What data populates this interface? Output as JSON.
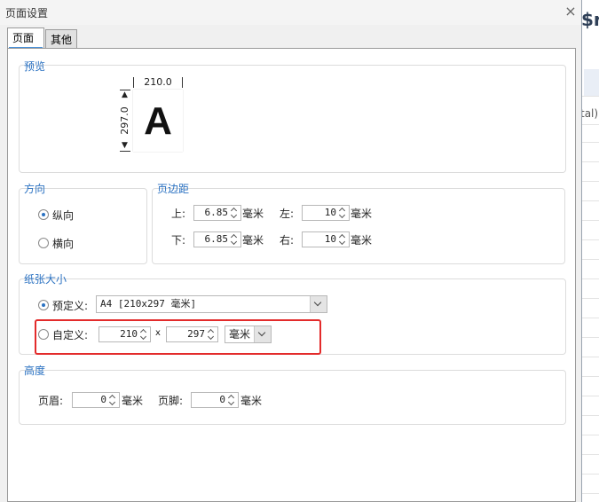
{
  "background": {
    "heading": "$r",
    "snippet": "tal)"
  },
  "dialog": {
    "title": "页面设置",
    "close_glyph": "×",
    "tabs": [
      {
        "label": "页面",
        "active": true
      },
      {
        "label": "其他",
        "active": false
      }
    ],
    "preview": {
      "label": "预览",
      "width": "210.0",
      "height": "297.0",
      "letter": "A"
    },
    "orientation": {
      "label": "方向",
      "portrait": "纵向",
      "landscape": "横向",
      "selected": "纵向"
    },
    "margins": {
      "label": "页边距",
      "top_label": "上:",
      "top": "6.85",
      "left_label": "左:",
      "left": "10",
      "bottom_label": "下:",
      "bottom": "6.85",
      "right_label": "右:",
      "right": "10",
      "unit": "毫米"
    },
    "paper": {
      "label": "纸张大小",
      "predefined_label": "预定义:",
      "predefined_value": "A4 [210x297 毫米]",
      "custom_label": "自定义:",
      "custom_width": "210",
      "times": "x",
      "custom_height": "297",
      "custom_unit": "毫米",
      "selected": "预定义"
    },
    "height_section": {
      "label": "高度",
      "header_label": "页眉:",
      "header": "0",
      "footer_label": "页脚:",
      "footer": "0",
      "unit": "毫米"
    }
  },
  "colors": {
    "accent": "#2b72c2",
    "highlight": "#e32b2b"
  }
}
